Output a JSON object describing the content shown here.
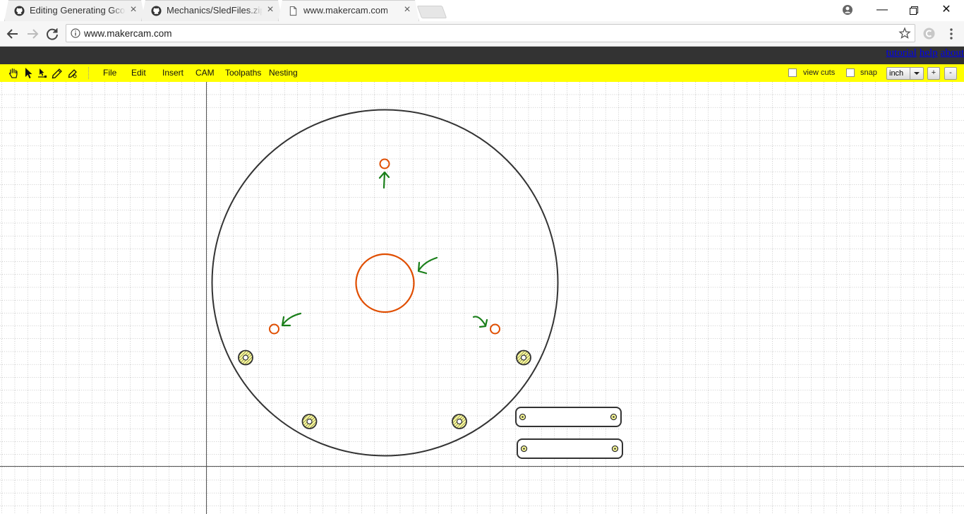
{
  "browser": {
    "tabs": [
      {
        "title": "Editing Generating Gcode",
        "icon": "github-icon",
        "active": false
      },
      {
        "title": "Mechanics/SledFiles.zip at",
        "icon": "github-icon",
        "active": false
      },
      {
        "title": "www.makercam.com",
        "icon": "page-icon",
        "active": true
      }
    ],
    "url": "www.makercam.com",
    "window_controls": [
      "minimize",
      "restore",
      "close"
    ]
  },
  "site": {
    "links": [
      "tutorial",
      "help",
      "about"
    ]
  },
  "app": {
    "tools": [
      "hand-tool-icon",
      "pointer-tool-icon",
      "node-tool-icon",
      "pen-tool-icon",
      "pen-edit-tool-icon"
    ],
    "menus": [
      "File",
      "Edit",
      "Insert",
      "CAM",
      "Toolpaths",
      "Nesting"
    ],
    "view_cuts_label": "view cuts",
    "view_cuts_checked": false,
    "snap_label": "snap",
    "snap_checked": false,
    "units": "inch",
    "zoom_in": "+",
    "zoom_out": "-"
  },
  "colors": {
    "header_bg": "#333333",
    "menubar_bg": "#ffff00",
    "selected_path": "#e04e00",
    "annotation": "#1a7f1a",
    "shape_stroke": "#333333"
  }
}
